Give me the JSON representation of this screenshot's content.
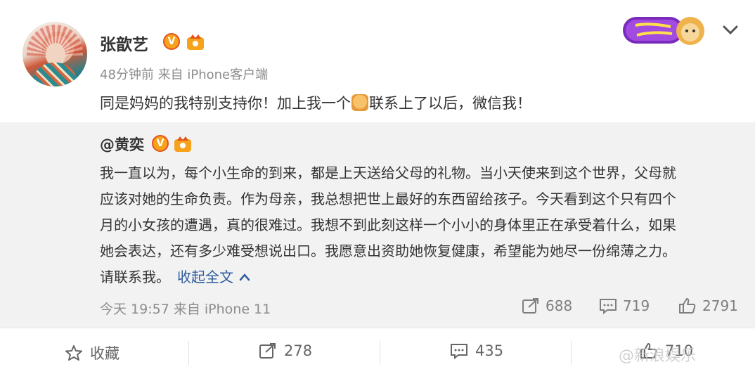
{
  "post": {
    "author": "张歆艺",
    "verified_badge": "V",
    "meta": "48分钟前 来自 iPhone客户端",
    "text_part1": "同是妈妈的我特别支持你！加上我一个",
    "text_part2": "联系上了以后，微信我！"
  },
  "repost": {
    "author": "@黄奕",
    "verified_badge": "V",
    "lines": [
      "我一直以为，每个小生命的到来，都是上天送给父母的礼物。当小天使来到这个世界，父母就",
      "应该对她的生命负责。作为母亲，我总想把世上最好的东西留给孩子。今天看到这个只有四个",
      "月的小女孩的遭遇，真的很难过。我想不到此刻这样一个小小的身体里正在承受着什么，如果",
      "她会表达，还有多少难受想说出口。我愿意出资助她恢复健康，希望能为她尽一份绵薄之力。"
    ],
    "last_line": "请联系我。",
    "collapse_label": "收起全文",
    "meta": "今天 19:57 来自 iPhone 11",
    "stats": {
      "reposts": "688",
      "comments": "719",
      "likes": "2791"
    }
  },
  "actions": {
    "favorite_label": "收藏",
    "repost_count": "278",
    "comment_count": "435",
    "like_count": "710"
  },
  "watermark": "@新浪娱乐",
  "colors": {
    "link": "#2f5d9b",
    "badge": "#f7a21b",
    "repost_bg": "#f2f2f2"
  }
}
